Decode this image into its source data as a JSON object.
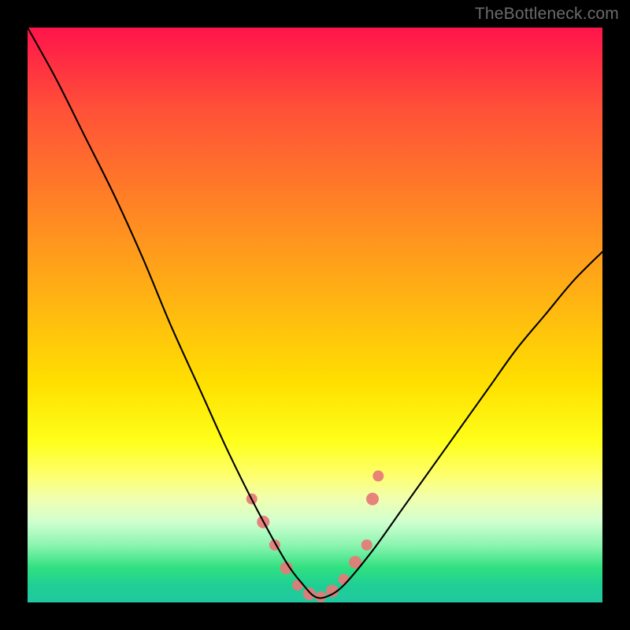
{
  "watermark": "TheBottleneck.com",
  "colors": {
    "background": "#000000",
    "curve": "#000000",
    "marker": "#e77877"
  },
  "chart_data": {
    "type": "line",
    "title": "",
    "xlabel": "",
    "ylabel": "",
    "xlim": [
      0,
      100
    ],
    "ylim": [
      0,
      100
    ],
    "series": [
      {
        "name": "bottleneck-curve",
        "x": [
          0,
          5,
          10,
          15,
          20,
          25,
          30,
          35,
          40,
          45,
          48,
          50,
          52,
          55,
          60,
          65,
          70,
          75,
          80,
          85,
          90,
          95,
          100
        ],
        "y": [
          100,
          91,
          81,
          71,
          60,
          48,
          37,
          26,
          16,
          7,
          3,
          1,
          1,
          3,
          9,
          16,
          23,
          30,
          37,
          44,
          50,
          56,
          61
        ]
      }
    ],
    "valley_markers": [
      {
        "x": 39,
        "y": 18
      },
      {
        "x": 41,
        "y": 14
      },
      {
        "x": 43,
        "y": 10
      },
      {
        "x": 45,
        "y": 6
      },
      {
        "x": 47,
        "y": 3
      },
      {
        "x": 49,
        "y": 1.5
      },
      {
        "x": 51,
        "y": 1
      },
      {
        "x": 53,
        "y": 2
      },
      {
        "x": 55,
        "y": 4
      },
      {
        "x": 57,
        "y": 7
      },
      {
        "x": 59,
        "y": 10
      },
      {
        "x": 60,
        "y": 18
      },
      {
        "x": 61,
        "y": 22
      }
    ]
  }
}
